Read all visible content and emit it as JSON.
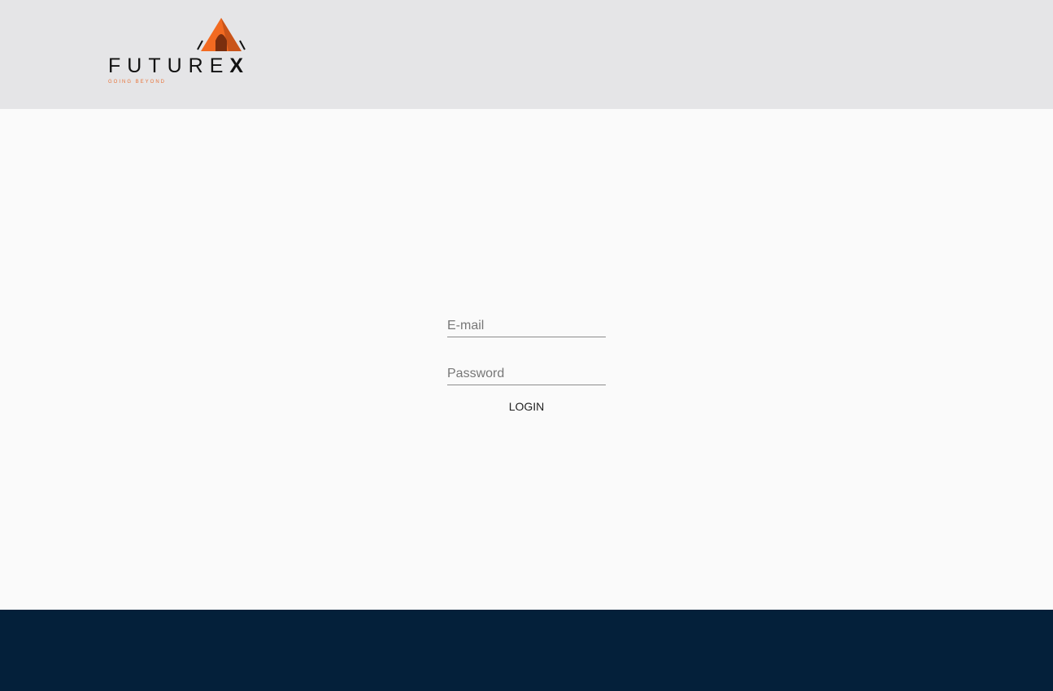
{
  "header": {
    "logo": {
      "wordmark": "FUTURE",
      "wordmark_x": "X",
      "tagline": "GOING BEYOND",
      "tent_colors": [
        "#f26a21",
        "#c9541a",
        "#7a2e0e",
        "#111111"
      ]
    }
  },
  "login_form": {
    "email_placeholder": "E-mail",
    "email_value": "",
    "password_placeholder": "Password",
    "password_value": "",
    "login_label": "LOGIN"
  },
  "colors": {
    "header_bg": "#e5e5e7",
    "main_bg": "#fafafa",
    "footer_bg": "#04203a",
    "accent": "#f26a21"
  }
}
